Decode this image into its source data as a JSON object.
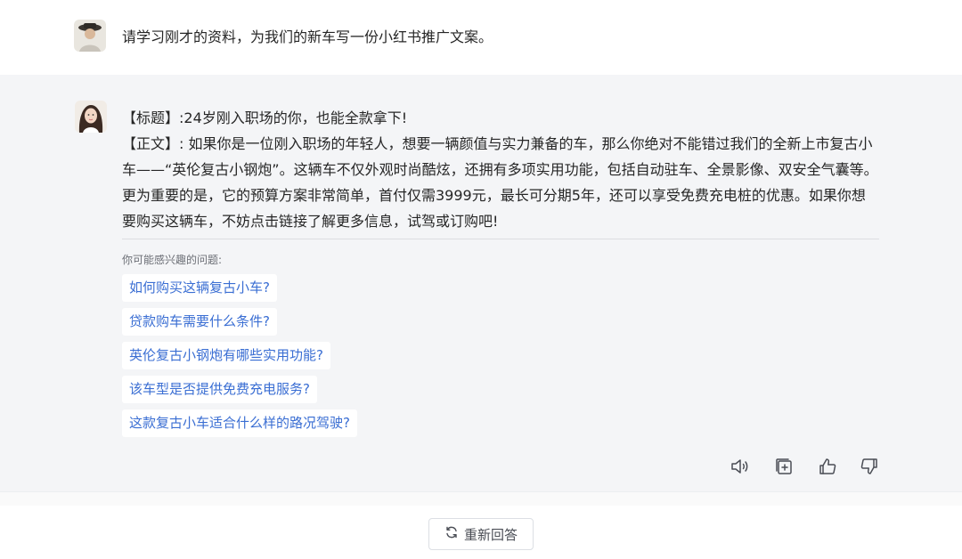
{
  "user": {
    "message": "请学习刚才的资料，为我们的新车写一份小红书推广文案。"
  },
  "answer": {
    "line1": "【标题】:24岁刚入职场的你，也能全款拿下!",
    "line2": "【正文】: 如果你是一位刚入职场的年轻人，想要一辆颜值与实力兼备的车，那么你绝对不能错过我们的全新上市复古小车——“英伦复古小钢炮”。这辆车不仅外观时尚酷炫，还拥有多项实用功能，包括自动驻车、全景影像、双安全气囊等。更为重要的是，它的预算方案非常简单，首付仅需3999元，最长可分期5年，还可以享受免费充电桩的优惠。如果你想要购买这辆车，不妨点击链接了解更多信息，试驾或订购吧!"
  },
  "suggestions": {
    "title": "你可能感兴趣的问题:",
    "items": [
      "如何购买这辆复古小车?",
      "贷款购车需要什么条件?",
      "英伦复古小钢炮有哪些实用功能?",
      "该车型是否提供免费充电服务?",
      "这款复古小车适合什么样的路况驾驶?"
    ]
  },
  "actions": {
    "icons": [
      "speaker-icon",
      "copy-icon",
      "thumbs-up-icon",
      "thumbs-down-icon"
    ]
  },
  "footer": {
    "regenerate_label": "重新回答"
  },
  "colors": {
    "panel_bg": "#f4f5f7",
    "link": "#3a6ed3",
    "text": "#262626"
  }
}
